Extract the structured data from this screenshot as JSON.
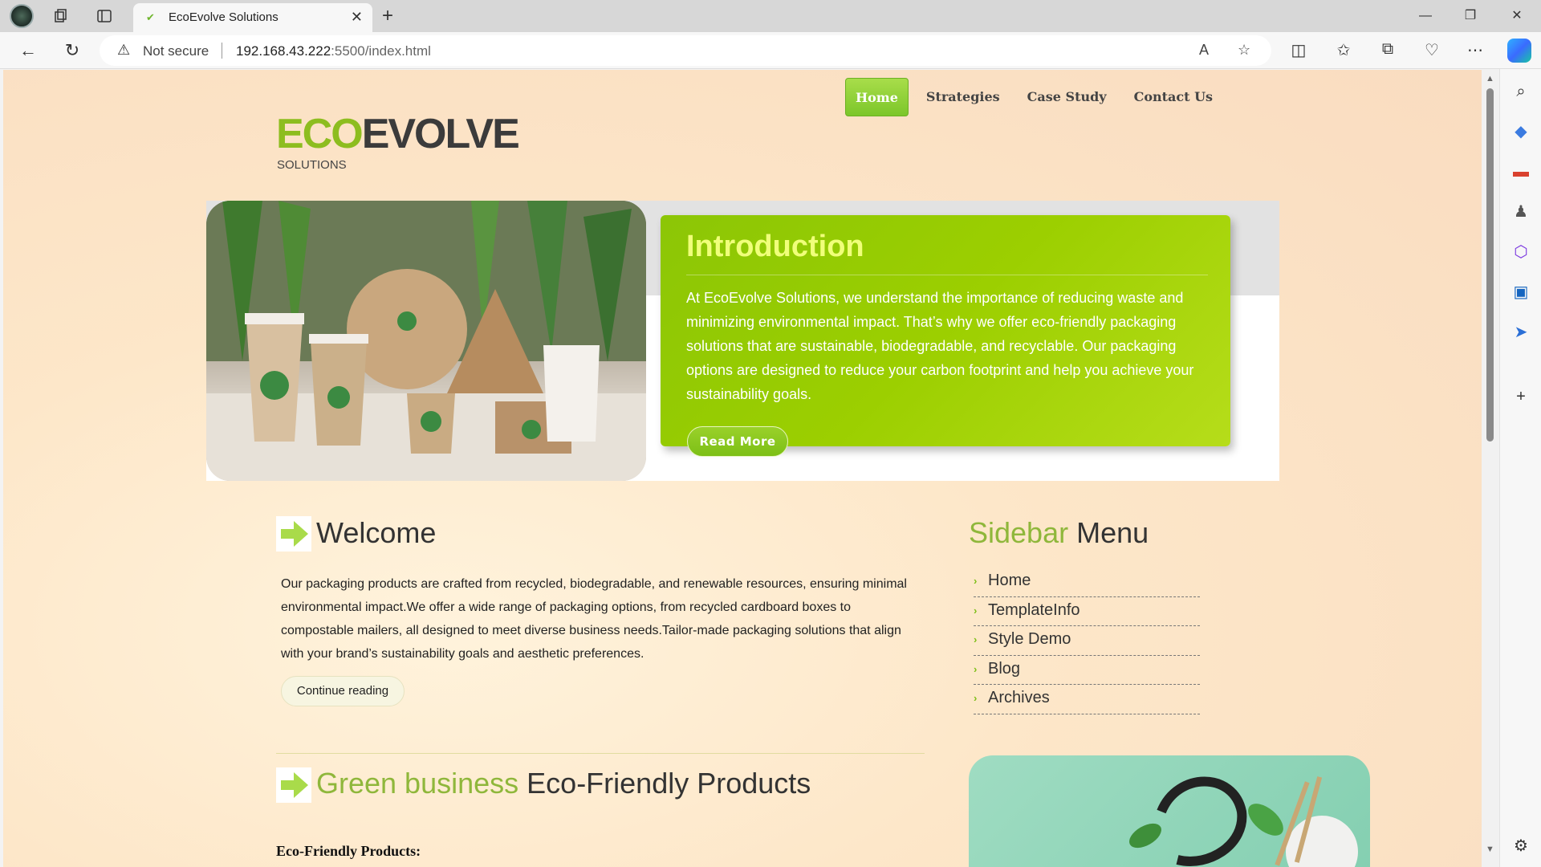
{
  "browser": {
    "tab_title": "EcoEvolve Solutions",
    "security_label": "Not secure",
    "url_host": "192.168.43.222",
    "url_rest": ":5500/index.html"
  },
  "site": {
    "nav": [
      "Home",
      "Strategies",
      "Case Study",
      "Contact Us"
    ],
    "logo_eco": "ECO",
    "logo_evolve": "EVOLVE",
    "logo_sub": "SOLUTIONS",
    "intro": {
      "title": "Introduction",
      "text": "At EcoEvolve Solutions, we understand the importance of reducing waste and minimizing environmental impact. That’s why we offer eco-friendly packaging solutions that are sustainable, biodegradable, and recyclable. Our packaging options are designed to reduce your carbon footprint and help you achieve your sustainability goals.",
      "button": "Read More"
    },
    "welcome": {
      "title": "Welcome",
      "text": "Our packaging products are crafted from recycled, biodegradable, and renewable resources, ensuring minimal environmental impact.We offer a wide range of packaging options, from recycled cardboard boxes to compostable mailers, all designed to meet diverse business needs.Tailor-made packaging solutions that align with your brand’s sustainability goals and aesthetic preferences.",
      "button": "Continue reading"
    },
    "sidebar": {
      "title_green": "Sidebar",
      "title_dark": "Menu",
      "items": [
        "Home",
        "TemplateInfo",
        "Style Demo",
        "Blog",
        "Archives"
      ]
    },
    "green_section": {
      "title_green": "Green business",
      "title_dark": "Eco-Friendly Products",
      "subhead": "Eco-Friendly Products:"
    }
  },
  "colors": {
    "accent_green": "#8dbd1f",
    "intro_card": "#9ccf00",
    "page_bg": "#fde7c9"
  }
}
